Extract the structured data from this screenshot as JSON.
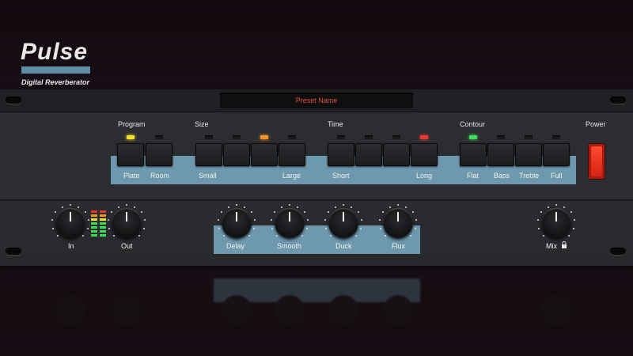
{
  "preset_name": "Preset Name",
  "logo": {
    "title": "Pulse",
    "subtitle": "Digital Reverberator"
  },
  "groups": {
    "program": {
      "label": "Program",
      "buttons": [
        "Plate",
        "Room"
      ]
    },
    "size": {
      "label": "Size",
      "buttons": [
        "Small",
        "Large"
      ]
    },
    "time": {
      "label": "Time",
      "buttons": [
        "Short",
        "Long"
      ]
    },
    "contour": {
      "label": "Contour",
      "buttons": [
        "Flat",
        "Bass",
        "Treble",
        "Full"
      ]
    },
    "power": {
      "label": "Power"
    }
  },
  "knobs": {
    "in": "In",
    "out": "Out",
    "delay": "Delay",
    "smooth": "Smooth",
    "duck": "Duck",
    "flux": "Flux",
    "mix": "Mix"
  },
  "colors": {
    "accent_band": "#6d98ad",
    "led_yellow": "#f2de2c",
    "led_orange": "#f0962c",
    "led_red": "#e4392c",
    "led_green": "#3fdc5a",
    "power_red": "#d52312",
    "preset_text": "#e34d3e"
  },
  "active_leds": {
    "program": 1,
    "size": 3,
    "time": 4,
    "contour": 1
  }
}
